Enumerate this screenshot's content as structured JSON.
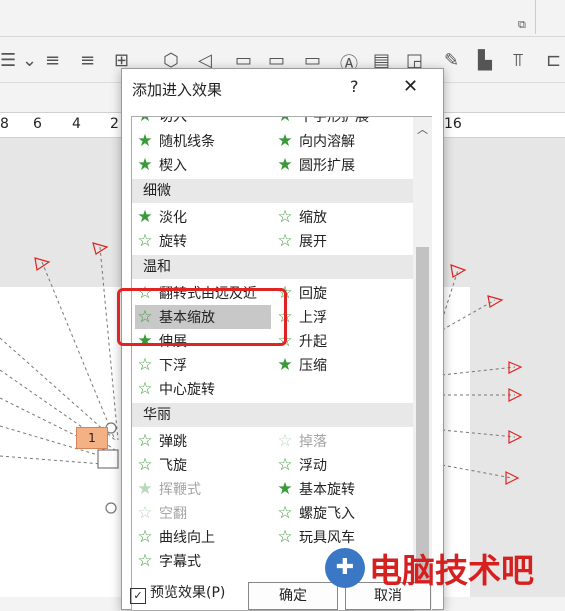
{
  "dialog": {
    "title": "添加进入效果",
    "help": "?",
    "close": "✕"
  },
  "ruler": {
    "left_labels": [
      "8",
      "6",
      "4",
      "2"
    ],
    "right_label": "16"
  },
  "slide_tag": "1",
  "categories": [
    {
      "label": "细微"
    },
    {
      "label": "温和"
    },
    {
      "label": "华丽"
    }
  ],
  "effects_top": [
    "切入",
    "十字形扩展",
    "随机线条",
    "向内溶解",
    "楔入",
    "圆形扩展"
  ],
  "effects_subtle": [
    "淡化",
    "缩放",
    "旋转",
    "展开"
  ],
  "effects_moderate": [
    "翻转式由远及近",
    "回旋",
    "基本缩放",
    "上浮",
    "伸展",
    "升起",
    "下浮",
    "压缩",
    "中心旋转"
  ],
  "effects_exciting": [
    "弹跳",
    "掉落",
    "飞旋",
    "浮动",
    "挥鞭式",
    "基本旋转",
    "空翻",
    "螺旋飞入",
    "曲线向上",
    "玩具风车",
    "字幕式"
  ],
  "preview": {
    "label": "预览效果(P)",
    "checked": "✓"
  },
  "buttons": {
    "ok": "确定",
    "cancel": "取消"
  },
  "watermark": {
    "text": "电脑技术吧"
  },
  "colors": {
    "highlight_box": "#e02424",
    "star": "#3a9a3a",
    "selected_row": "#c8c8c8"
  }
}
